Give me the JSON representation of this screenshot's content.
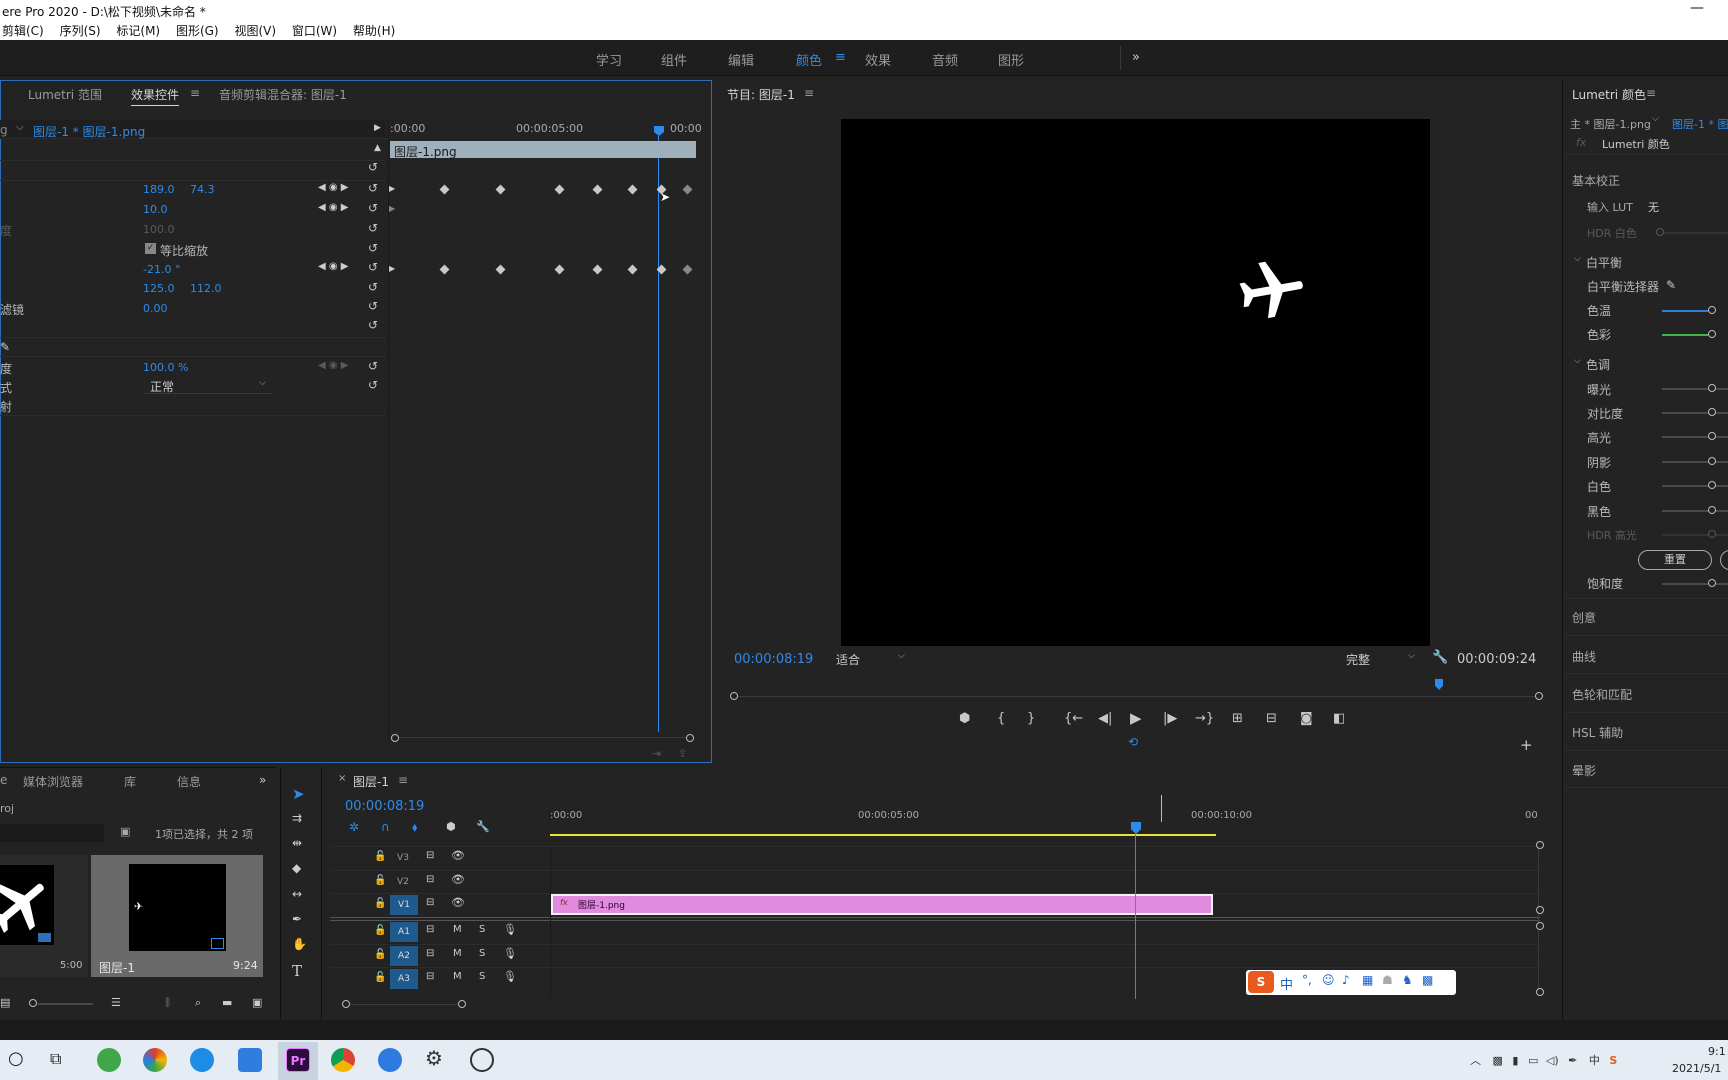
{
  "window": {
    "title": "ere Pro 2020 - D:\\松下视频\\未命名 *"
  },
  "menu": [
    "剪辑(C)",
    "序列(S)",
    "标记(M)",
    "图形(G)",
    "视图(V)",
    "窗口(W)",
    "帮助(H)"
  ],
  "workspaces": {
    "items": [
      "学习",
      "组件",
      "编辑",
      "颜色",
      "效果",
      "音频",
      "图形"
    ],
    "active": "颜色",
    "overflow": "»"
  },
  "source_panel": {
    "tabs": [
      "Lumetri 范围",
      "效果控件",
      "音频剪辑混合器: 图层-1"
    ],
    "active_tab": "效果控件",
    "clip_selector": "图层-1 * 图层-1.png",
    "timeline_ticks": [
      ":00:00",
      "00:00:05:00",
      "00:00"
    ],
    "clip_bar_label": "图层-1.png",
    "rows": [
      {
        "label": "",
        "v1": "189.0",
        "v2": "74.3"
      },
      {
        "label": "",
        "v1": "10.0",
        "v2": ""
      },
      {
        "label": "度",
        "v1": "100.0",
        "v2": ""
      },
      {
        "label": "",
        "checkbox": "等比缩放"
      },
      {
        "label": "",
        "v1": "-21.0 °",
        "v2": ""
      },
      {
        "label": "",
        "v1": "125.0",
        "v2": "112.0"
      },
      {
        "label": "滤镜",
        "v1": "0.00",
        "v2": ""
      },
      {
        "label": "度",
        "v1": "100.0 %",
        "v2": ""
      },
      {
        "label": "式",
        "select": "正常"
      },
      {
        "label": "射"
      }
    ]
  },
  "program_monitor": {
    "title": "节目: 图层-1",
    "timecode": "00:00:08:19",
    "fit": "适合",
    "quality": "完整",
    "duration": "00:00:09:24"
  },
  "lumetri": {
    "title": "Lumetri 颜色",
    "source": "主 * 图层-1.png",
    "sequence": "图层-1 * 图",
    "effect": "Lumetri 颜色",
    "sections": {
      "basic": "基本校正",
      "creative": "创意",
      "curves": "曲线",
      "wheels": "色轮和匹配",
      "hsl": "HSL 辅助",
      "vignette": "晕影"
    },
    "input_lut_label": "输入 LUT",
    "input_lut_value": "无",
    "hdr_white": "HDR 白色",
    "white_balance": "白平衡",
    "wb_selector": "白平衡选择器",
    "temp": "色温",
    "tint": "色彩",
    "tone": "色调",
    "tone_sliders": [
      "曝光",
      "对比度",
      "高光",
      "阴影",
      "白色",
      "黑色"
    ],
    "hdr_highlight": "HDR 高光",
    "reset": "重置",
    "saturation": "饱和度"
  },
  "project_panel": {
    "tabs": [
      "媒体浏览器",
      "库",
      "信息"
    ],
    "project_name": "roj",
    "selection_info": "1项已选择，共 2 项",
    "items": [
      {
        "name": "",
        "duration": "5:00"
      },
      {
        "name": "图层-1",
        "duration": "9:24"
      }
    ]
  },
  "timeline": {
    "tab": "图层-1",
    "timecode": "00:00:08:19",
    "ruler": [
      ":00:00",
      "00:00:05:00",
      "00:00:10:00",
      "00"
    ],
    "video_tracks": [
      "V3",
      "V2",
      "V1"
    ],
    "audio_tracks": [
      "A1",
      "A2",
      "A3"
    ],
    "clip_label": "图层-1.png",
    "clip_fx": "fx"
  },
  "ime": {
    "label": "中"
  },
  "taskbar": {
    "time": "9:1",
    "date": "2021/5/1",
    "ime": "中"
  }
}
